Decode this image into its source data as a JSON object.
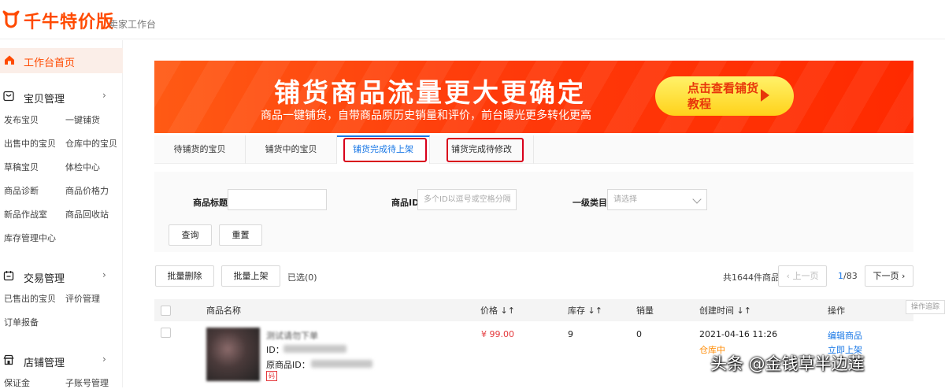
{
  "header": {
    "logo_text": "千牛特价版",
    "subtitle": "卖家工作台"
  },
  "sidebar": {
    "home": "工作台首页",
    "sections": [
      {
        "title": "宝贝管理",
        "items": [
          "发布宝贝",
          "一键铺货",
          "出售中的宝贝",
          "仓库中的宝贝",
          "草稿宝贝",
          "体检中心",
          "商品诊断",
          "商品价格力",
          "新品作战室",
          "商品回收站",
          "库存管理中心"
        ]
      },
      {
        "title": "交易管理",
        "items": [
          "已售出的宝贝",
          "评价管理",
          "订单报备"
        ]
      },
      {
        "title": "店铺管理",
        "items": [
          "保证金",
          "子账号管理"
        ]
      }
    ],
    "chevron": "›"
  },
  "banner": {
    "title": "铺货商品流量更大更确定",
    "subtitle": "商品一键铺货，自带商品原历史销量和评价，前台曝光更多转化更高",
    "cta": "点击查看铺货教程"
  },
  "tabs": [
    "待铺货的宝贝",
    "铺货中的宝贝",
    "铺货完成待上架",
    "铺货完成待修改"
  ],
  "filter": {
    "title_label": "商品标题",
    "id_label": "商品ID",
    "id_placeholder": "多个ID以逗号或空格分隔",
    "category_label": "一级类目",
    "category_value": "请选择",
    "search": "查询",
    "reset": "重置"
  },
  "toolbar": {
    "batch_delete": "批量删除",
    "batch_list": "批量上架",
    "selected": "已选(0)",
    "total": "共1644件商品",
    "prev": "‹ 上一页",
    "page_current": "1",
    "page_total": "/83",
    "next": "下一页 ›"
  },
  "table": {
    "columns": [
      "商品名称",
      "价格 ↓↑",
      "库存 ↓↑",
      "销量",
      "创建时间 ↓↑",
      "操作"
    ],
    "trace_button": "操作追踪",
    "rows": [
      {
        "name": "测试请勿下单",
        "id_label": "ID：",
        "orig_id_label": "原商品ID：",
        "tag": "码",
        "price": "¥ 99.00",
        "stock": "9",
        "sales": "0",
        "created": "2021-04-16 11:26",
        "location": "仓库中",
        "action_edit": "编辑商品",
        "action_list": "立即上架"
      }
    ]
  },
  "watermark": "头条 @金钱草半边莲",
  "colors": {
    "brand": "#ff4a00",
    "link": "#1a78e6",
    "highlight": "#d9001b",
    "price": "#e4393c"
  }
}
